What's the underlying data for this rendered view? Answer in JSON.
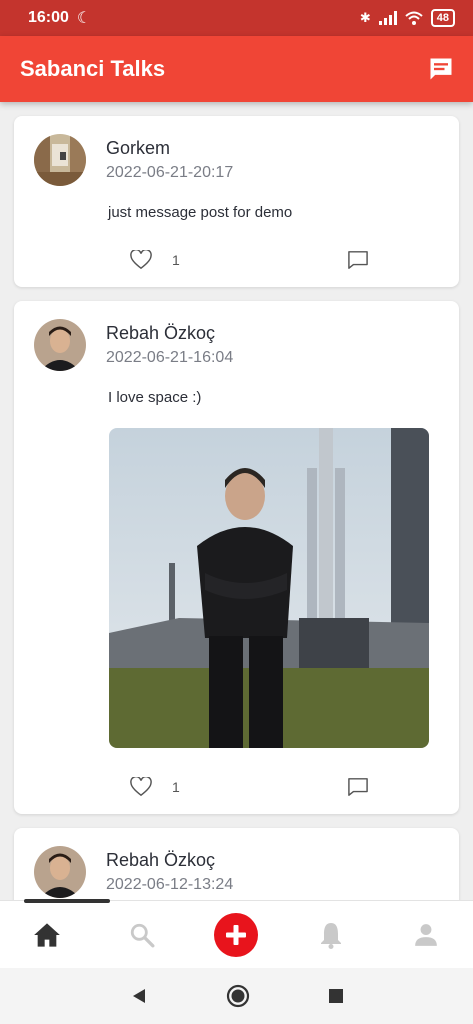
{
  "status_bar": {
    "time": "16:00",
    "battery": "48"
  },
  "app_bar": {
    "title": "Sabanci Talks"
  },
  "posts": [
    {
      "author": "Gorkem",
      "timestamp": "2022-06-21-20:17",
      "text": "just message post for demo",
      "likes": "1",
      "has_image": false
    },
    {
      "author": "Rebah Özkoç",
      "timestamp": "2022-06-21-16:04",
      "text": "I love space :)",
      "likes": "1",
      "has_image": true
    },
    {
      "author": "Rebah Özkoç",
      "timestamp": "2022-06-12-13:24"
    }
  ],
  "tabs": [
    "home-icon",
    "search-icon",
    "add-icon",
    "bell-icon",
    "profile-icon"
  ],
  "colors": {
    "status_bar": "#c4342d",
    "app_bar": "#f04536",
    "add_button": "#e8141c"
  }
}
